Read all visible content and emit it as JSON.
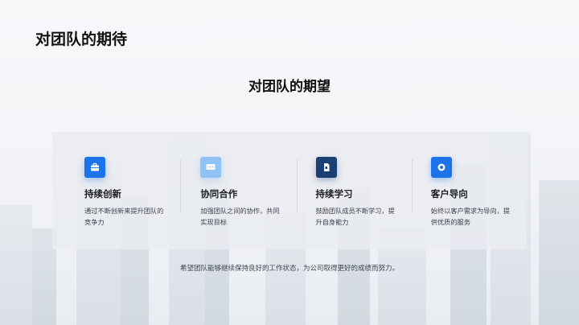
{
  "page": {
    "title": "对团队的期待"
  },
  "section": {
    "title": "对团队的期望"
  },
  "cards": [
    {
      "icon": "briefcase-icon",
      "icon_color": "#1a73e8",
      "title": "持续创新",
      "desc": "通过不断创新来提升团队的竞争力"
    },
    {
      "icon": "chat-bubble-icon",
      "icon_color": "#8fc3f5",
      "title": "协同合作",
      "desc": "加强团队之间的协作，共同实现目标"
    },
    {
      "icon": "document-icon",
      "icon_color": "#1c3f73",
      "title": "持续学习",
      "desc": "鼓励团队成员不断学习，提升自身能力"
    },
    {
      "icon": "target-icon",
      "icon_color": "#1a73e8",
      "title": "客户导向",
      "desc": "始终以客户需求为导向，提供优质的服务"
    }
  ],
  "footer": {
    "text": "希望团队能够继续保持良好的工作状态，为公司取得更好的成绩而努力。"
  }
}
